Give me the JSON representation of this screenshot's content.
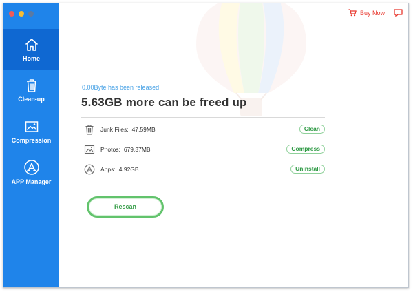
{
  "window": {
    "traffic_lights": [
      "close",
      "minimize",
      "zoom"
    ]
  },
  "sidebar": {
    "items": [
      {
        "label": "Home",
        "icon": "home-icon",
        "active": true
      },
      {
        "label": "Clean-up",
        "icon": "trash-icon",
        "active": false
      },
      {
        "label": "Compression",
        "icon": "image-icon",
        "active": false
      },
      {
        "label": "APP Manager",
        "icon": "app-store-icon",
        "active": false
      }
    ]
  },
  "header": {
    "buy_now": "Buy Now",
    "message_icon": "message-icon"
  },
  "main": {
    "released_text": "0.00Byte has been released",
    "headline": "5.63GB more can be freed up",
    "rows": [
      {
        "label": "Junk Files:",
        "value": "47.59MB",
        "action": "Clean",
        "icon": "trash-icon"
      },
      {
        "label": "Photos:",
        "value": "679.37MB",
        "action": "Compress",
        "icon": "photo-icon"
      },
      {
        "label": "Apps:",
        "value": "4.92GB",
        "action": "Uninstall",
        "icon": "app-icon"
      }
    ],
    "rescan_label": "Rescan"
  },
  "colors": {
    "sidebar": "#1f84ea",
    "sidebar_active": "#0f68d2",
    "accent_green": "#2f9a45",
    "buy_red": "#e8362c",
    "released_blue": "#4aa3e6"
  }
}
